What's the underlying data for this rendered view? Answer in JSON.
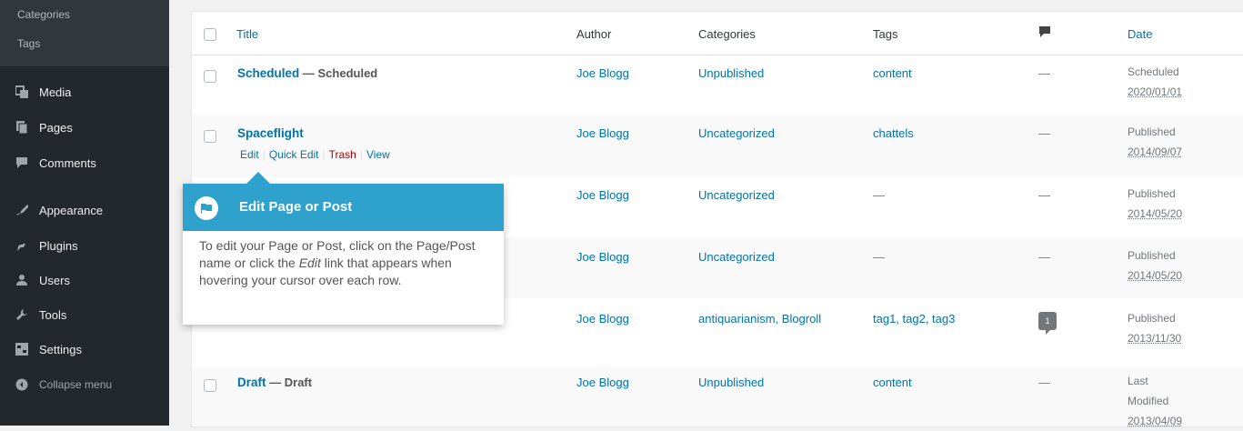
{
  "sidebar": {
    "submenu": [
      "Categories",
      "Tags"
    ],
    "items": [
      {
        "label": "Media",
        "icon": "media-icon"
      },
      {
        "label": "Pages",
        "icon": "pages-icon"
      },
      {
        "label": "Comments",
        "icon": "comments-icon"
      },
      {
        "label": "Appearance",
        "icon": "appearance-icon"
      },
      {
        "label": "Plugins",
        "icon": "plugins-icon"
      },
      {
        "label": "Users",
        "icon": "users-icon"
      },
      {
        "label": "Tools",
        "icon": "tools-icon"
      },
      {
        "label": "Settings",
        "icon": "settings-icon"
      },
      {
        "label": "Collapse menu",
        "icon": "collapse-icon"
      }
    ]
  },
  "table": {
    "headers": {
      "title": "Title",
      "author": "Author",
      "categories": "Categories",
      "tags": "Tags",
      "date": "Date"
    },
    "rows": [
      {
        "title": "Scheduled",
        "state": "— Scheduled",
        "author": "Joe Blogg",
        "categories": "Unpublished",
        "tags": "content",
        "comments": "—",
        "date_status": "Scheduled",
        "date": "2020/01/01"
      },
      {
        "title": "Spaceflight",
        "state": "",
        "author": "Joe Blogg",
        "categories": "Uncategorized",
        "tags": "chattels",
        "comments": "—",
        "date_status": "Published",
        "date": "2014/09/07",
        "actions": {
          "edit": "Edit",
          "quick_edit": "Quick Edit",
          "trash": "Trash",
          "view": "View"
        }
      },
      {
        "title": "",
        "state": "",
        "author": "Joe Blogg",
        "categories": "Uncategorized",
        "tags": "—",
        "comments": "—",
        "date_status": "Published",
        "date": "2014/05/20"
      },
      {
        "title": "",
        "state": "",
        "author": "Joe Blogg",
        "categories": "Uncategorized",
        "tags": "—",
        "comments": "—",
        "date_status": "Published",
        "date": "2014/05/20"
      },
      {
        "title": "",
        "state": "",
        "author": "Joe Blogg",
        "categories": "antiquarianism, Blogroll",
        "tags": "tag1, tag2, tag3",
        "comments": "1",
        "date_status": "Published",
        "date": "2013/11/30"
      },
      {
        "title": "Draft",
        "state": "— Draft",
        "author": "Joe Blogg",
        "categories": "Unpublished",
        "tags": "content",
        "comments": "—",
        "date_status": "Last Modified",
        "date": "2013/04/09"
      }
    ]
  },
  "pointer": {
    "title": "Edit Page or Post",
    "body_1": "To edit your Page or Post, click on the Page/Post name or click the ",
    "body_em": "Edit",
    "body_2": " link that appears when hovering your cursor over each row."
  },
  "colors": {
    "accent": "#0073aa",
    "pointer": "#2ea2cc",
    "sidebar": "#23282d",
    "trash": "#a00"
  }
}
